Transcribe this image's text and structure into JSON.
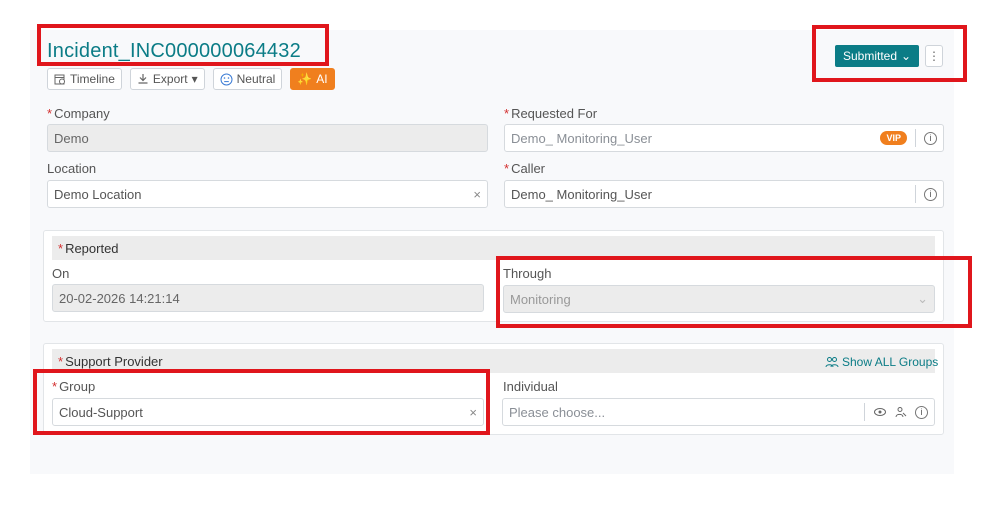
{
  "header": {
    "title": "Incident_INC000000064432",
    "status_label": "Submitted",
    "more_icon": "kebab-icon"
  },
  "toolbar": {
    "timeline": "Timeline",
    "export": "Export",
    "neutral": "Neutral",
    "ai": "AI"
  },
  "form": {
    "company_label": "Company",
    "company_value": "Demo",
    "requested_for_label": "Requested For",
    "requested_for_value": "Demo_ Monitoring_User",
    "vip_badge": "VIP",
    "location_label": "Location",
    "location_value": "Demo Location",
    "caller_label": "Caller",
    "caller_value": "Demo_ Monitoring_User"
  },
  "reported": {
    "section_label": "Reported",
    "on_label": "On",
    "on_value": "20-02-2026 14:21:14",
    "through_label": "Through",
    "through_value": "Monitoring"
  },
  "support": {
    "section_label": "Support Provider",
    "show_all_groups": "Show ALL Groups",
    "group_label": "Group",
    "group_value": "Cloud-Support",
    "individual_label": "Individual",
    "individual_placeholder": "Please choose..."
  },
  "colors": {
    "accent": "#0b7c86",
    "ai_orange": "#f07f1e",
    "highlight_red": "#e0161c",
    "required": "#d32f2f"
  }
}
